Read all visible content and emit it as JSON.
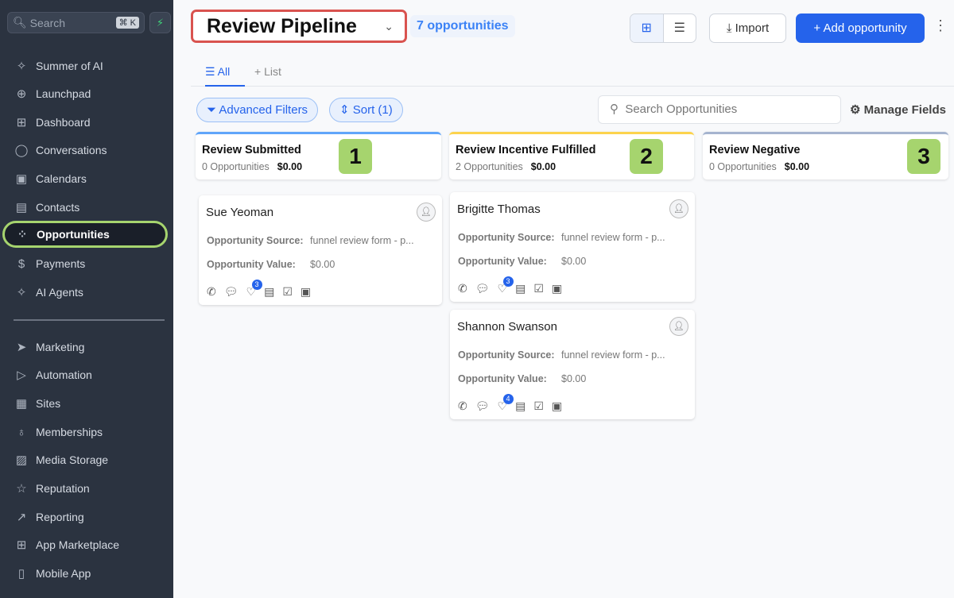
{
  "sidebar": {
    "search_placeholder": "Search",
    "shortcut": "⌘ K",
    "items": [
      {
        "label": "Summer of AI",
        "icon": "sparkle-icon",
        "glyph": "✧"
      },
      {
        "label": "Launchpad",
        "icon": "rocket-icon",
        "glyph": "⊕"
      },
      {
        "label": "Dashboard",
        "icon": "grid-icon",
        "glyph": "⊞"
      },
      {
        "label": "Conversations",
        "icon": "chat-icon",
        "glyph": "◯"
      },
      {
        "label": "Calendars",
        "icon": "calendar-icon",
        "glyph": "▣"
      },
      {
        "label": "Contacts",
        "icon": "contacts-icon",
        "glyph": "▤"
      },
      {
        "label": "Opportunities",
        "icon": "opportunities-icon",
        "glyph": "⁘"
      },
      {
        "label": "Payments",
        "icon": "payments-icon",
        "glyph": "$"
      },
      {
        "label": "AI Agents",
        "icon": "sparkle-icon",
        "glyph": "✧"
      },
      {
        "label": "Marketing",
        "icon": "send-icon",
        "glyph": "➤"
      },
      {
        "label": "Automation",
        "icon": "automation-icon",
        "glyph": "▷"
      },
      {
        "label": "Sites",
        "icon": "sites-icon",
        "glyph": "▦"
      },
      {
        "label": "Memberships",
        "icon": "award-icon",
        "glyph": "♁"
      },
      {
        "label": "Media Storage",
        "icon": "image-icon",
        "glyph": "▨"
      },
      {
        "label": "Reputation",
        "icon": "star-icon",
        "glyph": "☆"
      },
      {
        "label": "Reporting",
        "icon": "trend-icon",
        "glyph": "↗"
      },
      {
        "label": "App Marketplace",
        "icon": "apps-icon",
        "glyph": "⊞"
      },
      {
        "label": "Mobile App",
        "icon": "mobile-icon",
        "glyph": "▯"
      }
    ]
  },
  "header": {
    "pipeline": "Review Pipeline",
    "count": "7 opportunities",
    "import": "Import",
    "add": "+ Add opportunity"
  },
  "tabs": {
    "all": "All",
    "list": "+ List"
  },
  "filters": {
    "advanced": "Advanced Filters",
    "sort": "Sort (1)",
    "search_placeholder": "Search Opportunities",
    "manage": "Manage Fields"
  },
  "columns": [
    {
      "title": "Review Submitted",
      "count": "0 Opportunities",
      "value": "$0.00",
      "marker": "1",
      "color": "#60a5fa"
    },
    {
      "title": "Review Incentive Fulfilled",
      "count": "2 Opportunities",
      "value": "$0.00",
      "marker": "2",
      "color": "#fcd34d"
    },
    {
      "title": "Review Negative",
      "count": "0 Opportunities",
      "value": "$0.00",
      "marker": "3",
      "color": "#a5b4cf"
    }
  ],
  "cards": [
    {
      "name": "Sue Yeoman",
      "source_label": "Opportunity Source:",
      "source": "funnel review form - p...",
      "value_label": "Opportunity Value:",
      "value": "$0.00",
      "badge": "3"
    },
    {
      "name": "Brigitte Thomas",
      "source_label": "Opportunity Source:",
      "source": "funnel review form - p...",
      "value_label": "Opportunity Value:",
      "value": "$0.00",
      "badge": "3"
    },
    {
      "name": "Shannon Swanson",
      "source_label": "Opportunity Source:",
      "source": "funnel review form - p...",
      "value_label": "Opportunity Value:",
      "value": "$0.00",
      "badge": "4"
    }
  ]
}
